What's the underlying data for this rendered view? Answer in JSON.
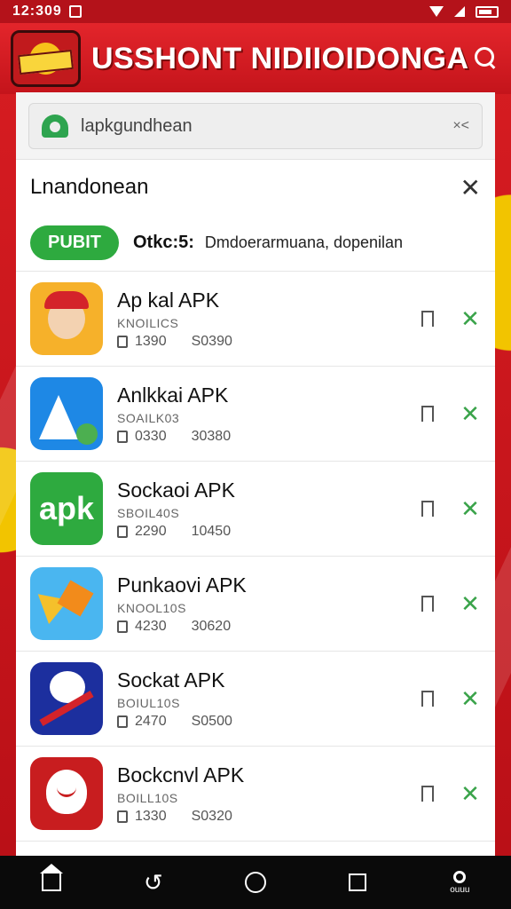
{
  "status_bar": {
    "time": "12:309"
  },
  "header": {
    "title": "USSHONT NIDIIOIDONGA"
  },
  "search": {
    "value": "lapkgundhean",
    "clear": "×<"
  },
  "section": {
    "title": "Lnandonean",
    "close": "✕"
  },
  "filter": {
    "chip": "PUBIT",
    "label": "Otkc:5:",
    "description": "Dmdoerarmuana, dopenilan"
  },
  "apps": [
    {
      "name": "Ap kal APK",
      "sub": "KNOILICS",
      "stat_a": "1390",
      "stat_b": "S0390",
      "x": "✕"
    },
    {
      "name": "Anlkkai APK",
      "sub": "SOAILK03",
      "stat_a": "0330",
      "stat_b": "30380",
      "x": "✕"
    },
    {
      "name": "Sockaoi APK",
      "sub": "SBOIL40S",
      "stat_a": "2290",
      "stat_b": "10450",
      "x": "✕"
    },
    {
      "name": "Punkaovi APK",
      "sub": "KNOOL10S",
      "stat_a": "4230",
      "stat_b": "30620",
      "x": "✕"
    },
    {
      "name": "Sockat APK",
      "sub": "BOIUL10S",
      "stat_a": "2470",
      "stat_b": "S0500",
      "x": "✕"
    },
    {
      "name": "Bockcnvl APK",
      "sub": "BOILL10S",
      "stat_a": "1330",
      "stat_b": "S0320",
      "x": "✕"
    }
  ],
  "nav": {
    "back": "↺",
    "profile_label": "ouuu"
  }
}
